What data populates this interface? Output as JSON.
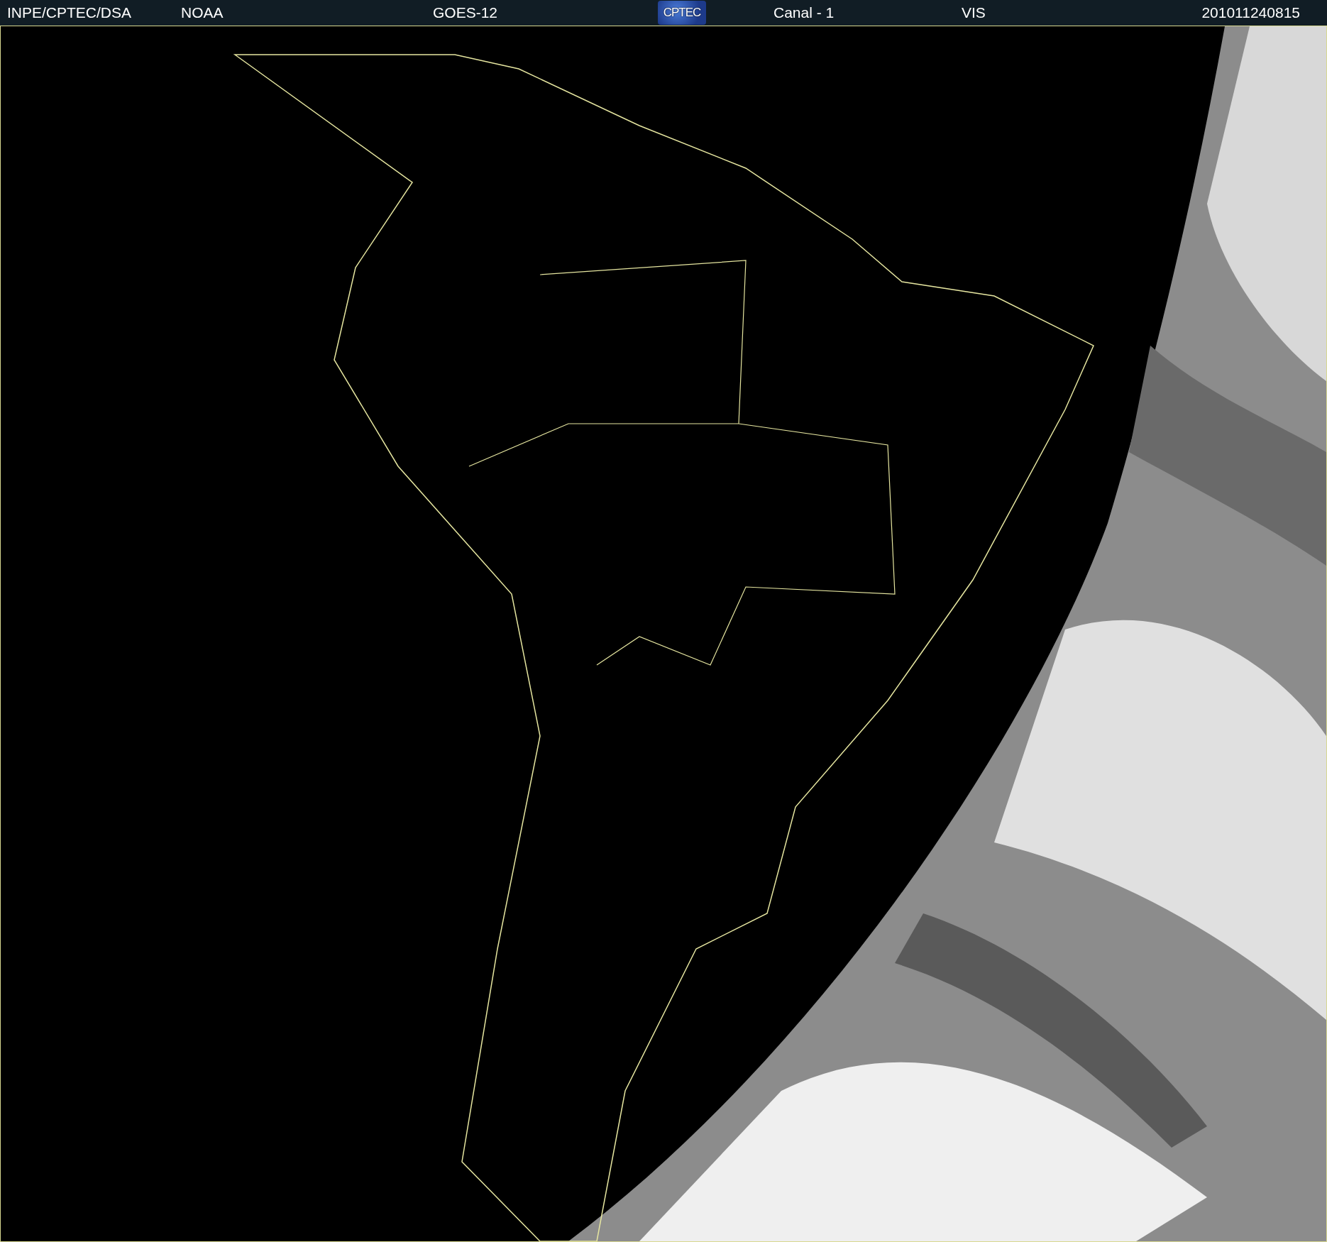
{
  "header": {
    "source": "INPE/CPTEC/DSA",
    "agency": "NOAA",
    "satellite": "GOES-12",
    "logo": "CPTEC",
    "channel": "Canal - 1",
    "band": "VIS",
    "timestamp": "201011240815"
  }
}
